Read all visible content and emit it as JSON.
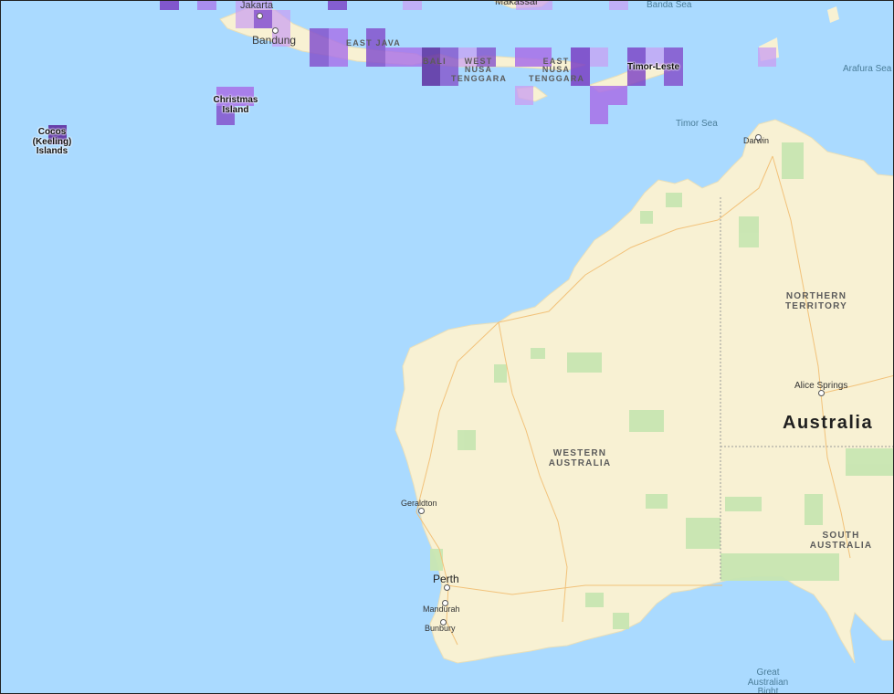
{
  "map": {
    "place_labels": {
      "jakarta": "Jakarta",
      "bandung": "Bandung",
      "makassar": "Makassar",
      "banda_sea": "Banda Sea",
      "east_java": "EAST JAVA",
      "bali": "BALI",
      "west_nusa_tenggara": "WEST NUSA TENGGARA",
      "east_nusa_tenggara": "EAST NUSA TENGGARA",
      "timor_leste": "Timor-Leste",
      "arafura_sea": "Arafura Sea",
      "timor_sea": "Timor Sea",
      "christmas_island": "Christmas Island",
      "cocos_islands": "Cocos (Keeling) Islands",
      "darwin": "Darwin",
      "northern_territory": "NORTHERN TERRITORY",
      "alice_springs": "Alice Springs",
      "australia": "Australia",
      "western_australia": "WESTERN AUSTRALIA",
      "south_australia": "SOUTH AUSTRALIA",
      "geraldton": "Geraldton",
      "perth": "Perth",
      "mandurah": "Mandurah",
      "bunbury": "Bunbury",
      "great_australian_bight": "Great Australian Bight"
    },
    "colors": {
      "water": "#aadaff",
      "land": "#f8f1d3",
      "park": "#c8e6b2",
      "overlay_dark": "#6a3aa8",
      "overlay_mid": "#9b5ee0",
      "overlay_light": "#c694f5"
    }
  }
}
